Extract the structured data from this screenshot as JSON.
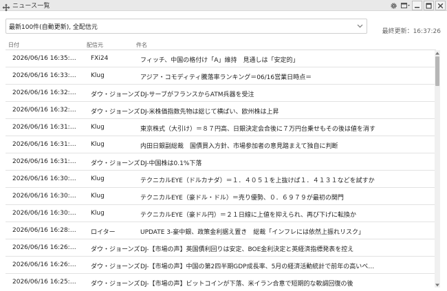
{
  "window": {
    "title": "ニュース一覧"
  },
  "filter": {
    "selected": "最新100件(自動更新), 全配信元"
  },
  "status": {
    "last_update": "最終更新：16:37:26"
  },
  "columns": {
    "date": "日付",
    "source": "配信元",
    "title": "件名"
  },
  "rows": [
    {
      "date": "2026/06/16 16:35:…",
      "source": "FXi24",
      "title": "フィッチ、中国の格付け「A」維持　見通しは「安定的」"
    },
    {
      "date": "2026/06/16 16:33:…",
      "source": "Klug",
      "title": "アジア・コモディティ騰落率ランキング＝06/16営業日時点＝"
    },
    {
      "date": "2026/06/16 16:32:…",
      "source": "ダウ・ジョーンズ",
      "title": "DJ-サーブがフランスからATM兵器を受注"
    },
    {
      "date": "2026/06/16 16:32:…",
      "source": "ダウ・ジョーンズ",
      "title": "DJ-米株価指数先物は総じて横ばい、欧州株は上昇"
    },
    {
      "date": "2026/06/16 16:31:…",
      "source": "Klug",
      "title": "東京株式（大引け）＝８７円高、日銀決定会合後に７万円台乗せもその後は値を消す"
    },
    {
      "date": "2026/06/16 16:31:…",
      "source": "Klug",
      "title": "内田日銀副総裁　国債買入方針、市場参加者の意見踏まえて独自に判断"
    },
    {
      "date": "2026/06/16 16:31:…",
      "source": "ダウ・ジョーンズ",
      "title": "DJ-中国株は0.1%下落"
    },
    {
      "date": "2026/06/16 16:30:…",
      "source": "Klug",
      "title": "テクニカルEYE（ドルカナダ）＝１．４０５１を上抜けば１．４１３１などを試すか"
    },
    {
      "date": "2026/06/16 16:30:…",
      "source": "Klug",
      "title": "テクニカルEYE（豪ドル・ドル）＝売り優勢、０．６９７９が最初の関門"
    },
    {
      "date": "2026/06/16 16:30:…",
      "source": "Klug",
      "title": "テクニカルEYE（豪ドル円）＝２１日線に上値を抑えられ、再び下げに転換か"
    },
    {
      "date": "2026/06/16 16:28:…",
      "source": "ロイター",
      "title": "UPDATE 3-豪中銀、政策金利据え置き　総裁「インフレには依然上振れリスク」"
    },
    {
      "date": "2026/06/16 16:26:…",
      "source": "ダウ・ジョーンズ",
      "title": "DJ-【市場の声】英国債利回りは安定、BOE金利決定と英経済指標発表を控え"
    },
    {
      "date": "2026/06/16 16:26:…",
      "source": "ダウ・ジョーンズ",
      "title": "DJ-【市場の声】中国の第2四半期GDP成長率、5月の経済活動統計で前年の高いベ…"
    },
    {
      "date": "2026/06/16 16:25:…",
      "source": "ダウ・ジョーンズ",
      "title": "DJ-【市場の声】ビットコインが下落、米イラン合意で短期的な軟調回復の後"
    }
  ]
}
